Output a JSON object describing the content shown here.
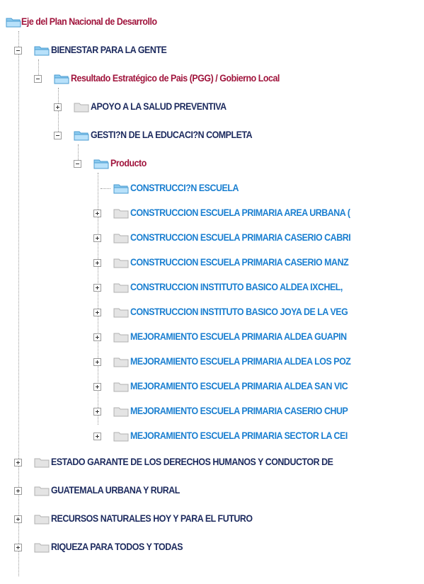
{
  "colors": {
    "red": "#a0143c",
    "navy": "#1c2a5e",
    "blue": "#1a7fd0"
  },
  "tree": {
    "root": {
      "label": "Eje del Plan Nacional de Desarrollo",
      "icon": "folder-open-icon"
    },
    "axis_bienestar": {
      "label": "BIENESTAR PARA LA GENTE",
      "state": "expanded"
    },
    "resultado": {
      "label": "Resultado Estratégico de Pais (PGG) / Gobierno Local",
      "state": "expanded"
    },
    "apoyo_salud": {
      "label": "APOYO A LA SALUD PREVENTIVA",
      "state": "collapsed"
    },
    "gestion_educacion": {
      "label": "GESTI?N DE LA EDUCACI?N COMPLETA",
      "state": "expanded"
    },
    "producto": {
      "label": "Producto",
      "state": "expanded"
    },
    "items": [
      {
        "label": "CONSTRUCCI?N ESCUELA",
        "state": "leaf"
      },
      {
        "label": "CONSTRUCCION ESCUELA PRIMARIA AREA URBANA (",
        "state": "collapsed"
      },
      {
        "label": "CONSTRUCCION ESCUELA PRIMARIA CASERIO CABRI",
        "state": "collapsed"
      },
      {
        "label": "CONSTRUCCION ESCUELA PRIMARIA CASERIO MANZ",
        "state": "collapsed"
      },
      {
        "label": "CONSTRUCCION INSTITUTO BASICO ALDEA IXCHEL,",
        "state": "collapsed"
      },
      {
        "label": "CONSTRUCCION INSTITUTO BASICO JOYA DE LA VEG",
        "state": "collapsed"
      },
      {
        "label": "MEJORAMIENTO ESCUELA PRIMARIA ALDEA GUAPIN",
        "state": "collapsed"
      },
      {
        "label": "MEJORAMIENTO ESCUELA PRIMARIA ALDEA LOS POZ",
        "state": "collapsed"
      },
      {
        "label": "MEJORAMIENTO ESCUELA PRIMARIA ALDEA SAN VIC",
        "state": "collapsed"
      },
      {
        "label": "MEJORAMIENTO ESCUELA PRIMARIA CASERIO CHUP",
        "state": "collapsed"
      },
      {
        "label": "MEJORAMIENTO ESCUELA PRIMARIA SECTOR LA CEI",
        "state": "collapsed"
      }
    ],
    "other_axes": [
      {
        "label": "ESTADO GARANTE DE LOS DERECHOS HUMANOS Y CONDUCTOR DE",
        "state": "collapsed"
      },
      {
        "label": "GUATEMALA URBANA Y RURAL",
        "state": "collapsed"
      },
      {
        "label": "RECURSOS NATURALES HOY Y PARA EL FUTURO",
        "state": "collapsed"
      },
      {
        "label": "RIQUEZA PARA TODOS Y TODAS",
        "state": "collapsed"
      }
    ]
  }
}
